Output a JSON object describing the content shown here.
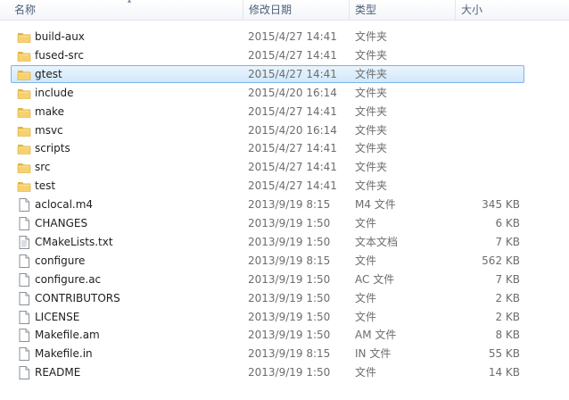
{
  "columns": {
    "name": "名称",
    "date_modified": "修改日期",
    "type": "类型",
    "size": "大小"
  },
  "files": [
    {
      "name": "build-aux",
      "date": "2015/4/27 14:41",
      "type": "文件夹",
      "size": "",
      "icon": "folder-icon",
      "selected": false
    },
    {
      "name": "fused-src",
      "date": "2015/4/27 14:41",
      "type": "文件夹",
      "size": "",
      "icon": "folder-icon",
      "selected": false
    },
    {
      "name": "gtest",
      "date": "2015/4/27 14:41",
      "type": "文件夹",
      "size": "",
      "icon": "folder-icon",
      "selected": true
    },
    {
      "name": "include",
      "date": "2015/4/20 16:14",
      "type": "文件夹",
      "size": "",
      "icon": "folder-icon",
      "selected": false
    },
    {
      "name": "make",
      "date": "2015/4/27 14:41",
      "type": "文件夹",
      "size": "",
      "icon": "folder-icon",
      "selected": false
    },
    {
      "name": "msvc",
      "date": "2015/4/20 16:14",
      "type": "文件夹",
      "size": "",
      "icon": "folder-icon",
      "selected": false
    },
    {
      "name": "scripts",
      "date": "2015/4/27 14:41",
      "type": "文件夹",
      "size": "",
      "icon": "folder-icon",
      "selected": false
    },
    {
      "name": "src",
      "date": "2015/4/27 14:41",
      "type": "文件夹",
      "size": "",
      "icon": "folder-icon",
      "selected": false
    },
    {
      "name": "test",
      "date": "2015/4/27 14:41",
      "type": "文件夹",
      "size": "",
      "icon": "folder-icon",
      "selected": false
    },
    {
      "name": "aclocal.m4",
      "date": "2013/9/19 8:15",
      "type": "M4 文件",
      "size": "345 KB",
      "icon": "file-icon",
      "selected": false
    },
    {
      "name": "CHANGES",
      "date": "2013/9/19 1:50",
      "type": "文件",
      "size": "6 KB",
      "icon": "file-icon",
      "selected": false
    },
    {
      "name": "CMakeLists.txt",
      "date": "2013/9/19 1:50",
      "type": "文本文档",
      "size": "7 KB",
      "icon": "text-file-icon",
      "selected": false
    },
    {
      "name": "configure",
      "date": "2013/9/19 8:15",
      "type": "文件",
      "size": "562 KB",
      "icon": "file-icon",
      "selected": false
    },
    {
      "name": "configure.ac",
      "date": "2013/9/19 1:50",
      "type": "AC 文件",
      "size": "7 KB",
      "icon": "file-icon",
      "selected": false
    },
    {
      "name": "CONTRIBUTORS",
      "date": "2013/9/19 1:50",
      "type": "文件",
      "size": "2 KB",
      "icon": "file-icon",
      "selected": false
    },
    {
      "name": "LICENSE",
      "date": "2013/9/19 1:50",
      "type": "文件",
      "size": "2 KB",
      "icon": "file-icon",
      "selected": false
    },
    {
      "name": "Makefile.am",
      "date": "2013/9/19 1:50",
      "type": "AM 文件",
      "size": "8 KB",
      "icon": "file-icon",
      "selected": false
    },
    {
      "name": "Makefile.in",
      "date": "2013/9/19 8:15",
      "type": "IN 文件",
      "size": "55 KB",
      "icon": "file-icon",
      "selected": false
    },
    {
      "name": "README",
      "date": "2013/9/19 1:50",
      "type": "文件",
      "size": "14 KB",
      "icon": "file-icon",
      "selected": false
    }
  ]
}
